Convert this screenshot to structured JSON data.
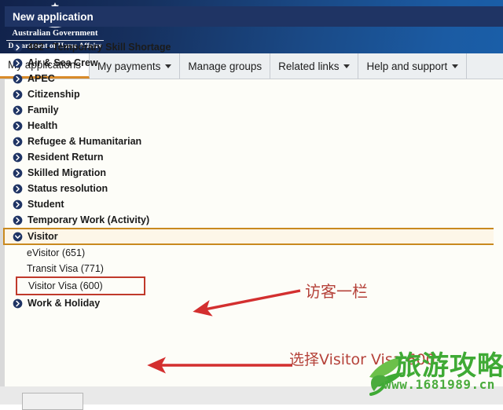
{
  "header": {
    "crest_icon": "australian-coat-of-arms",
    "line1": "Australian Government",
    "line2": "Department of Home Affairs"
  },
  "tabs": [
    {
      "label": "My applications",
      "has_caret": false,
      "active": true
    },
    {
      "label": "My payments",
      "has_caret": true,
      "active": false
    },
    {
      "label": "Manage groups",
      "has_caret": false,
      "active": false
    },
    {
      "label": "Related links",
      "has_caret": true,
      "active": false
    },
    {
      "label": "Help and support",
      "has_caret": true,
      "active": false
    }
  ],
  "section": {
    "banner_title": "New application"
  },
  "categories": [
    {
      "label": "482 - Temporary Skill Shortage",
      "icon": "chevron-right-circle-icon"
    },
    {
      "label": "Air & Sea Crew",
      "icon": "chevron-right-circle-icon"
    },
    {
      "label": "APEC",
      "icon": "chevron-right-circle-icon"
    },
    {
      "label": "Citizenship",
      "icon": "chevron-right-circle-icon"
    },
    {
      "label": "Family",
      "icon": "chevron-right-circle-icon"
    },
    {
      "label": "Health",
      "icon": "chevron-right-circle-icon"
    },
    {
      "label": "Refugee & Humanitarian",
      "icon": "chevron-right-circle-icon"
    },
    {
      "label": "Resident Return",
      "icon": "chevron-right-circle-icon"
    },
    {
      "label": "Skilled Migration",
      "icon": "chevron-right-circle-icon"
    },
    {
      "label": "Status resolution",
      "icon": "chevron-right-circle-icon"
    },
    {
      "label": "Student",
      "icon": "chevron-right-circle-icon"
    },
    {
      "label": "Temporary Work (Activity)",
      "icon": "chevron-right-circle-icon"
    }
  ],
  "visitor": {
    "label": "Visitor",
    "icon": "chevron-down-circle-icon",
    "expanded": true,
    "children": [
      {
        "label": "eVisitor (651)"
      },
      {
        "label": "Transit Visa (771)"
      },
      {
        "label": "Visitor Visa (600)",
        "highlighted": true
      }
    ]
  },
  "categories_after": [
    {
      "label": "Work & Holiday",
      "icon": "chevron-right-circle-icon"
    }
  ],
  "annotations": [
    {
      "name": "visitor-column-note",
      "text": "访客一栏"
    },
    {
      "name": "choose-visa-note",
      "text": "选择Visitor Visa 600"
    }
  ],
  "watermark": {
    "logo_icon": "leaf-swoosh-logo",
    "title": "旅游攻略",
    "url": "www.1681989.cn"
  },
  "colors": {
    "header_dark": "#11224b",
    "header_light": "#1a5ea8",
    "banner": "#1f3464",
    "active_tab_underline": "#d98b2b",
    "highlight_border": "#c9891f",
    "highlight_fill": "#fdf6e8",
    "red_box": "#c0392b",
    "arrow_red": "#d32f2f",
    "note_red": "#b5423a",
    "watermark_green": "#3faa35"
  }
}
